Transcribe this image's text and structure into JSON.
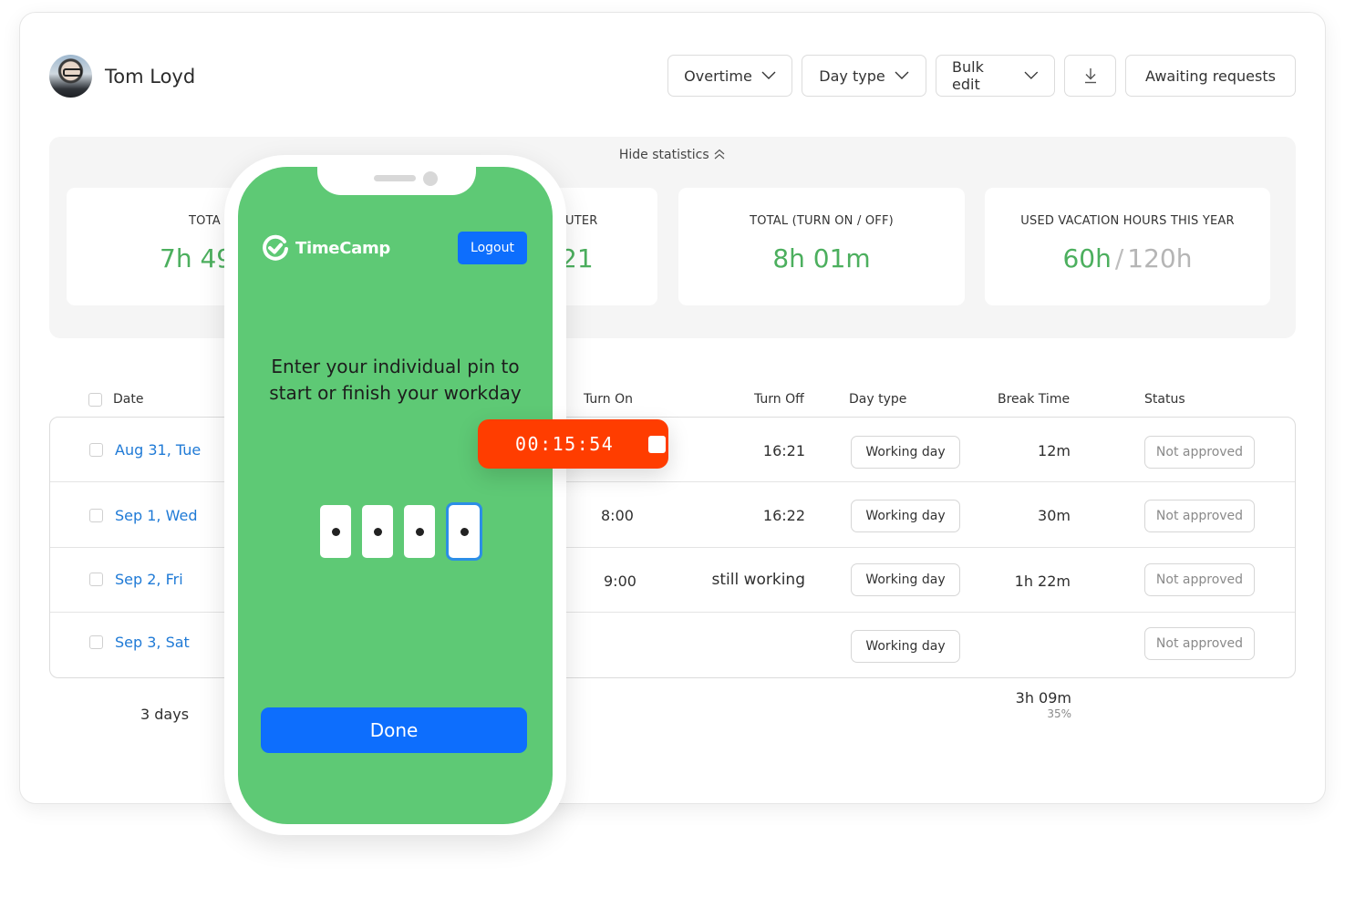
{
  "user": {
    "name": "Tom Loyd"
  },
  "toolbar": {
    "overtime": "Overtime",
    "day_type": "Day type",
    "bulk_edit": "Bulk edit",
    "download_icon": "download-icon",
    "awaiting": "Awaiting requests"
  },
  "stats": {
    "toggle_label": "Hide statistics",
    "cards": [
      {
        "label": "TOTA",
        "value": "7h 49"
      },
      {
        "label": "UTER",
        "value": "21"
      },
      {
        "label": "TOTAL (TURN ON / OFF)",
        "value": "8h 01m"
      },
      {
        "label": "USED VACATION HOURS THIS YEAR",
        "used": "60h",
        "separator": "/",
        "total": "120h"
      }
    ]
  },
  "table": {
    "headers": {
      "date": "Date",
      "turn_on": "Turn On",
      "turn_off": "Turn Off",
      "day_type": "Day type",
      "break_time": "Break Time",
      "status": "Status"
    },
    "rows": [
      {
        "date": "Aug 31, Tue",
        "turn_on": "",
        "turn_off": "16:21",
        "day_type": "Working day",
        "break_time": "12m",
        "status": "Not approved"
      },
      {
        "date": "Sep 1, Wed",
        "turn_on": "8:00",
        "turn_off": "16:22",
        "day_type": "Working day",
        "break_time": "30m",
        "status": "Not approved"
      },
      {
        "date": "Sep 2, Fri",
        "turn_on": "9:00",
        "turn_off": "still working",
        "day_type": "Working day",
        "break_time": "1h 22m",
        "status": "Not approved"
      },
      {
        "date": "Sep 3, Sat",
        "turn_on": "",
        "turn_off": "",
        "day_type": "Working day",
        "break_time": "",
        "status": "Not approved"
      }
    ],
    "footer": {
      "days": "3 days",
      "break_total": "3h 09m",
      "break_percent": "35%"
    }
  },
  "phone": {
    "brand": "TimeCamp",
    "logout": "Logout",
    "prompt": "Enter your individual pin to start or finish your workday",
    "pin_length": 4,
    "pin_filled": 4,
    "done": "Done"
  },
  "timer": {
    "elapsed": "00:15:54"
  },
  "colors": {
    "accent_green": "#4caf5e",
    "phone_bg": "#5ec975",
    "primary_blue": "#0d6efd",
    "link_blue": "#1f7ad6",
    "timer_red": "#ff3d00"
  }
}
